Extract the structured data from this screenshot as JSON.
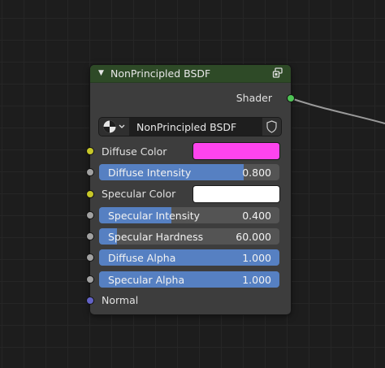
{
  "node": {
    "title": "NonPrincipled BSDF",
    "header_icon": "collapse-arrow-icon",
    "output_label": "Shader",
    "output_socket_color": "#4ec355",
    "node_group": {
      "name": "NonPrincipled BSDF",
      "type_icon": "node-group-icon",
      "fake_user_icon": "shield-icon"
    },
    "inputs": [
      {
        "kind": "color",
        "label": "Diffuse Color",
        "color": "#fe44ee",
        "socket_color": "#c7c729"
      },
      {
        "kind": "slider",
        "label": "Diffuse Intensity",
        "value": "0.800",
        "fraction": 0.8,
        "socket_color": "#a1a1a1"
      },
      {
        "kind": "color",
        "label": "Specular Color",
        "color": "#ffffff",
        "socket_color": "#c7c729"
      },
      {
        "kind": "slider",
        "label": "Specular Intensity",
        "value": "0.400",
        "fraction": 0.4,
        "socket_color": "#a1a1a1"
      },
      {
        "kind": "slider",
        "label": "Specular Hardness",
        "value": "60.000",
        "fraction": 0.1,
        "socket_color": "#a1a1a1"
      },
      {
        "kind": "slider",
        "label": "Diffuse Alpha",
        "value": "1.000",
        "fraction": 1.0,
        "socket_color": "#a1a1a1"
      },
      {
        "kind": "slider",
        "label": "Specular Alpha",
        "value": "1.000",
        "fraction": 1.0,
        "socket_color": "#a1a1a1"
      },
      {
        "kind": "vector",
        "label": "Normal",
        "socket_color": "#6363c7"
      }
    ]
  },
  "colors": {
    "header": "#2e4a27",
    "body": "#3d3d3d",
    "slider_fill": "#5680c2",
    "slider_bg": "#545454",
    "background": "#1d1d1d"
  }
}
